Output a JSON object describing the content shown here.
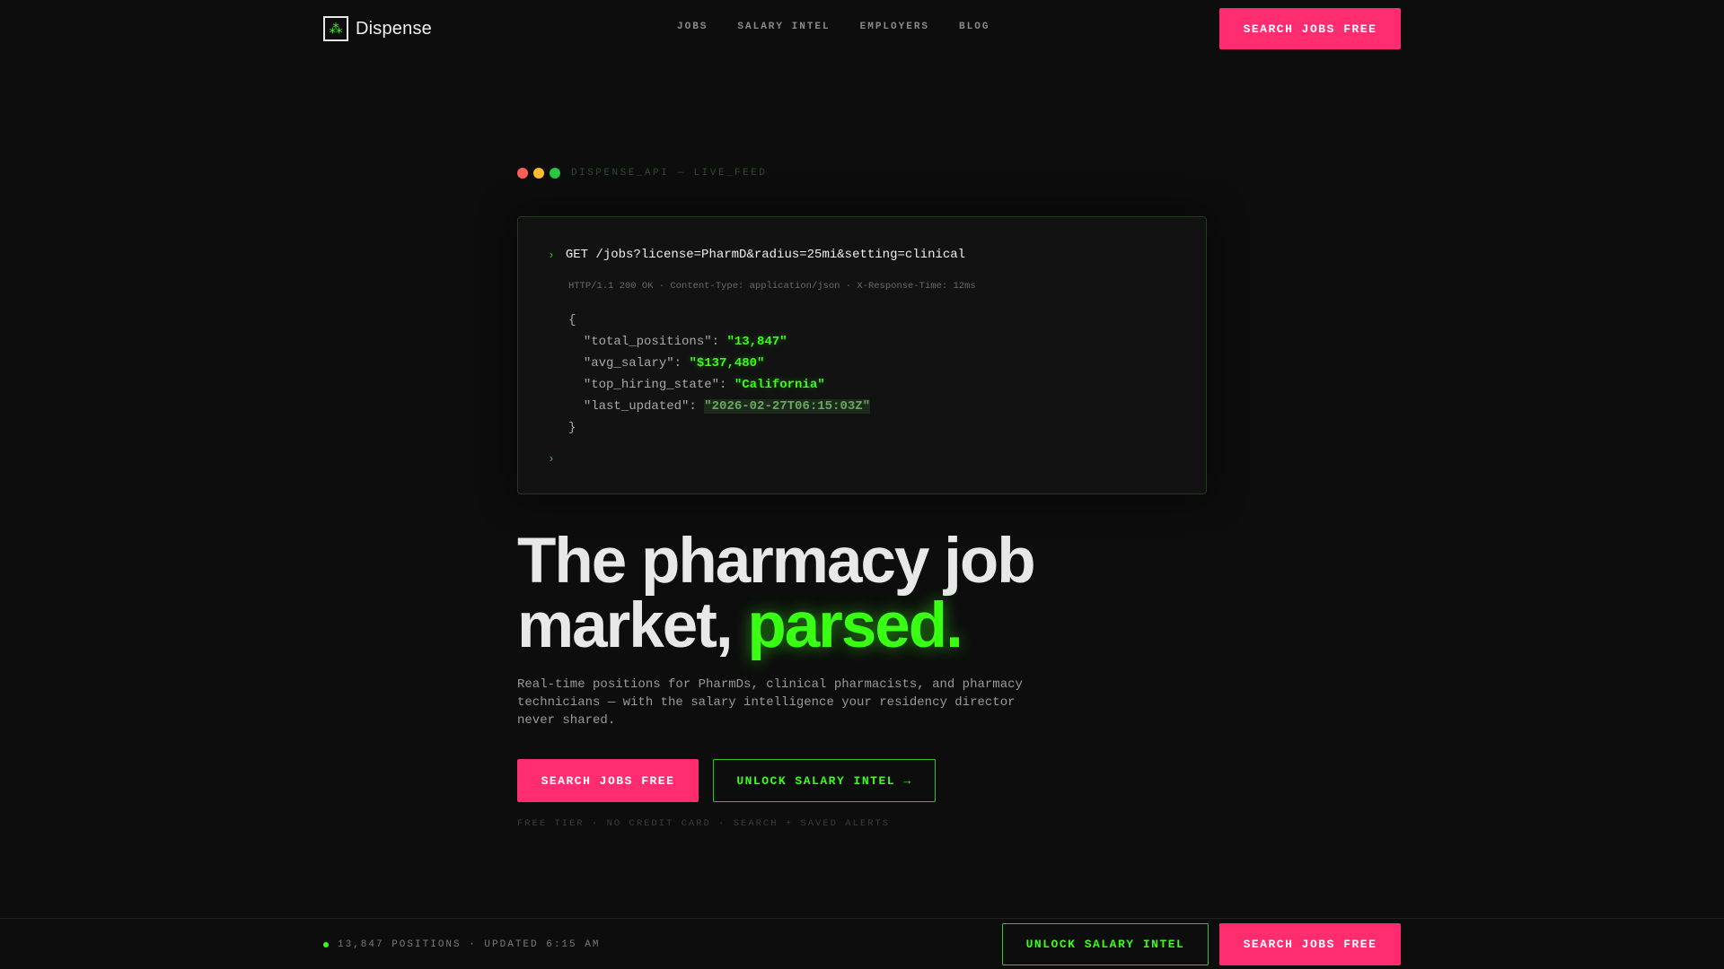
{
  "nav": {
    "logo_icon": "⁂",
    "logo_text": "Dispense",
    "links": [
      "JOBS",
      "SALARY INTEL",
      "EMPLOYERS",
      "BLOG"
    ],
    "cta": "SEARCH JOBS FREE"
  },
  "terminal": {
    "dot_colors": [
      "#ff5f57",
      "#febc2e",
      "#28c840"
    ],
    "label": "DISPENSE_API — LIVE_FEED",
    "prompt": "›",
    "command": "GET /jobs?license=PharmD&radius=25mi&setting=clinical",
    "meta": "HTTP/1.1 200 OK · Content-Type: application/json · X-Response-Time: 12ms",
    "open_brace": "{",
    "close_brace": "}",
    "fields": [
      {
        "key": "\"total_positions\": ",
        "value": "\"13,847\""
      },
      {
        "key": "\"avg_salary\": ",
        "value": "\"$137,480\""
      },
      {
        "key": "\"top_hiring_state\": ",
        "value": "\"California\""
      },
      {
        "key": "\"last_updated\": ",
        "value": "\"2026-02-27T06:15:03Z\""
      }
    ]
  },
  "hero": {
    "title_line1": "The pharmacy job",
    "title_line2_plain": "market, ",
    "title_accent": "parsed.",
    "subtitle": "Real-time positions for PharmDs, clinical pharmacists, and pharmacy technicians — with the salary intelligence your residency director never shared.",
    "cta_primary": "SEARCH JOBS FREE",
    "cta_secondary": "UNLOCK SALARY INTEL →",
    "fine_print": "FREE TIER · NO CREDIT CARD · SEARCH + SAVED ALERTS"
  },
  "bottom_bar": {
    "status": "13,847 POSITIONS · UPDATED 6:15 AM",
    "cta_outline": "UNLOCK SALARY INTEL",
    "cta_pink": "SEARCH JOBS FREE"
  },
  "colors": {
    "accent_green": "#39ff14",
    "accent_pink": "#ff2d6f",
    "background": "#0d0d0d"
  }
}
